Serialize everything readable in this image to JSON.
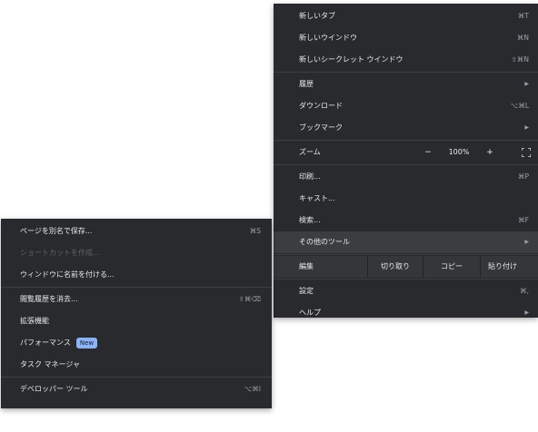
{
  "main_menu": {
    "new_tab": {
      "label": "新しいタブ",
      "shortcut": "⌘T"
    },
    "new_window": {
      "label": "新しいウインドウ",
      "shortcut": "⌘N"
    },
    "new_incognito": {
      "label": "新しいシークレット ウインドウ",
      "shortcut": "⇧⌘N"
    },
    "history": {
      "label": "履歴"
    },
    "downloads": {
      "label": "ダウンロード",
      "shortcut": "⌥⌘L"
    },
    "bookmarks": {
      "label": "ブックマーク"
    },
    "zoom": {
      "label": "ズーム",
      "minus": "−",
      "value": "100%",
      "plus": "+"
    },
    "print": {
      "label": "印刷...",
      "shortcut": "⌘P"
    },
    "cast": {
      "label": "キャスト..."
    },
    "find": {
      "label": "検索...",
      "shortcut": "⌘F"
    },
    "more_tools": {
      "label": "その他のツール"
    },
    "edit": {
      "label": "編集",
      "cut": "切り取り",
      "copy": "コピー",
      "paste": "貼り付け"
    },
    "settings": {
      "label": "設定",
      "shortcut": "⌘,"
    },
    "help": {
      "label": "ヘルプ"
    }
  },
  "sub_menu": {
    "save_page": {
      "label": "ページを別名で保存...",
      "shortcut": "⌘S"
    },
    "create_shortcut": {
      "label": "ショートカットを作成..."
    },
    "name_window": {
      "label": "ウィンドウに名前を付ける..."
    },
    "clear_data": {
      "label": "閲覧履歴を消去...",
      "shortcut": "⇧⌘⌫"
    },
    "extensions": {
      "label": "拡張機能"
    },
    "performance": {
      "label": "パフォーマンス",
      "badge": "New"
    },
    "task_manager": {
      "label": "タスク マネージャ"
    },
    "developer_tools": {
      "label": "デベロッパー ツール",
      "shortcut": "⌥⌘I"
    }
  },
  "colors": {
    "menu_bg": "#292a2d",
    "highlight": "#3c3d41",
    "badge": "#8ab4f8"
  },
  "icons": {
    "submenu_arrow": "chevron-right-icon",
    "fullscreen": "fullscreen-icon"
  }
}
